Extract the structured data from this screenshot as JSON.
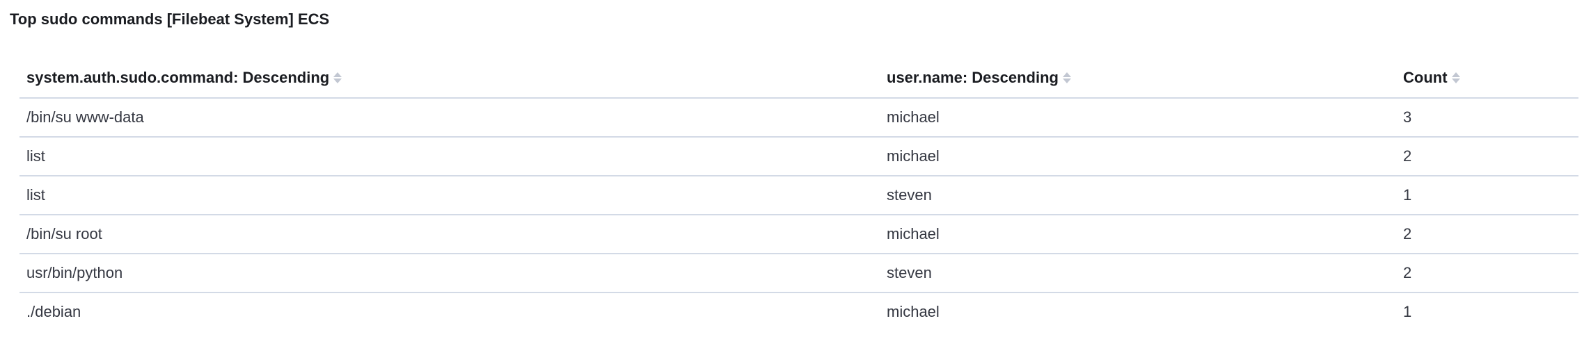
{
  "panel": {
    "title": "Top sudo commands [Filebeat System] ECS"
  },
  "table": {
    "columns": [
      {
        "label": "system.auth.sudo.command: Descending",
        "sort_icon": "sort-icon"
      },
      {
        "label": "user.name: Descending",
        "sort_icon": "sort-icon"
      },
      {
        "label": "Count",
        "sort_icon": "sort-icon"
      }
    ],
    "rows": [
      {
        "command": "/bin/su www-data",
        "user": "michael",
        "count": "3"
      },
      {
        "command": "list",
        "user": "michael",
        "count": "2"
      },
      {
        "command": "list",
        "user": "steven",
        "count": "1"
      },
      {
        "command": "/bin/su root",
        "user": "michael",
        "count": "2"
      },
      {
        "command": "usr/bin/python",
        "user": "steven",
        "count": "2"
      },
      {
        "command": "./debian",
        "user": "michael",
        "count": "1"
      }
    ]
  },
  "colors": {
    "border": "#d3dae6",
    "header_text": "#1a1c21",
    "cell_text": "#343741",
    "sort_icon": "#c2c7d2"
  }
}
